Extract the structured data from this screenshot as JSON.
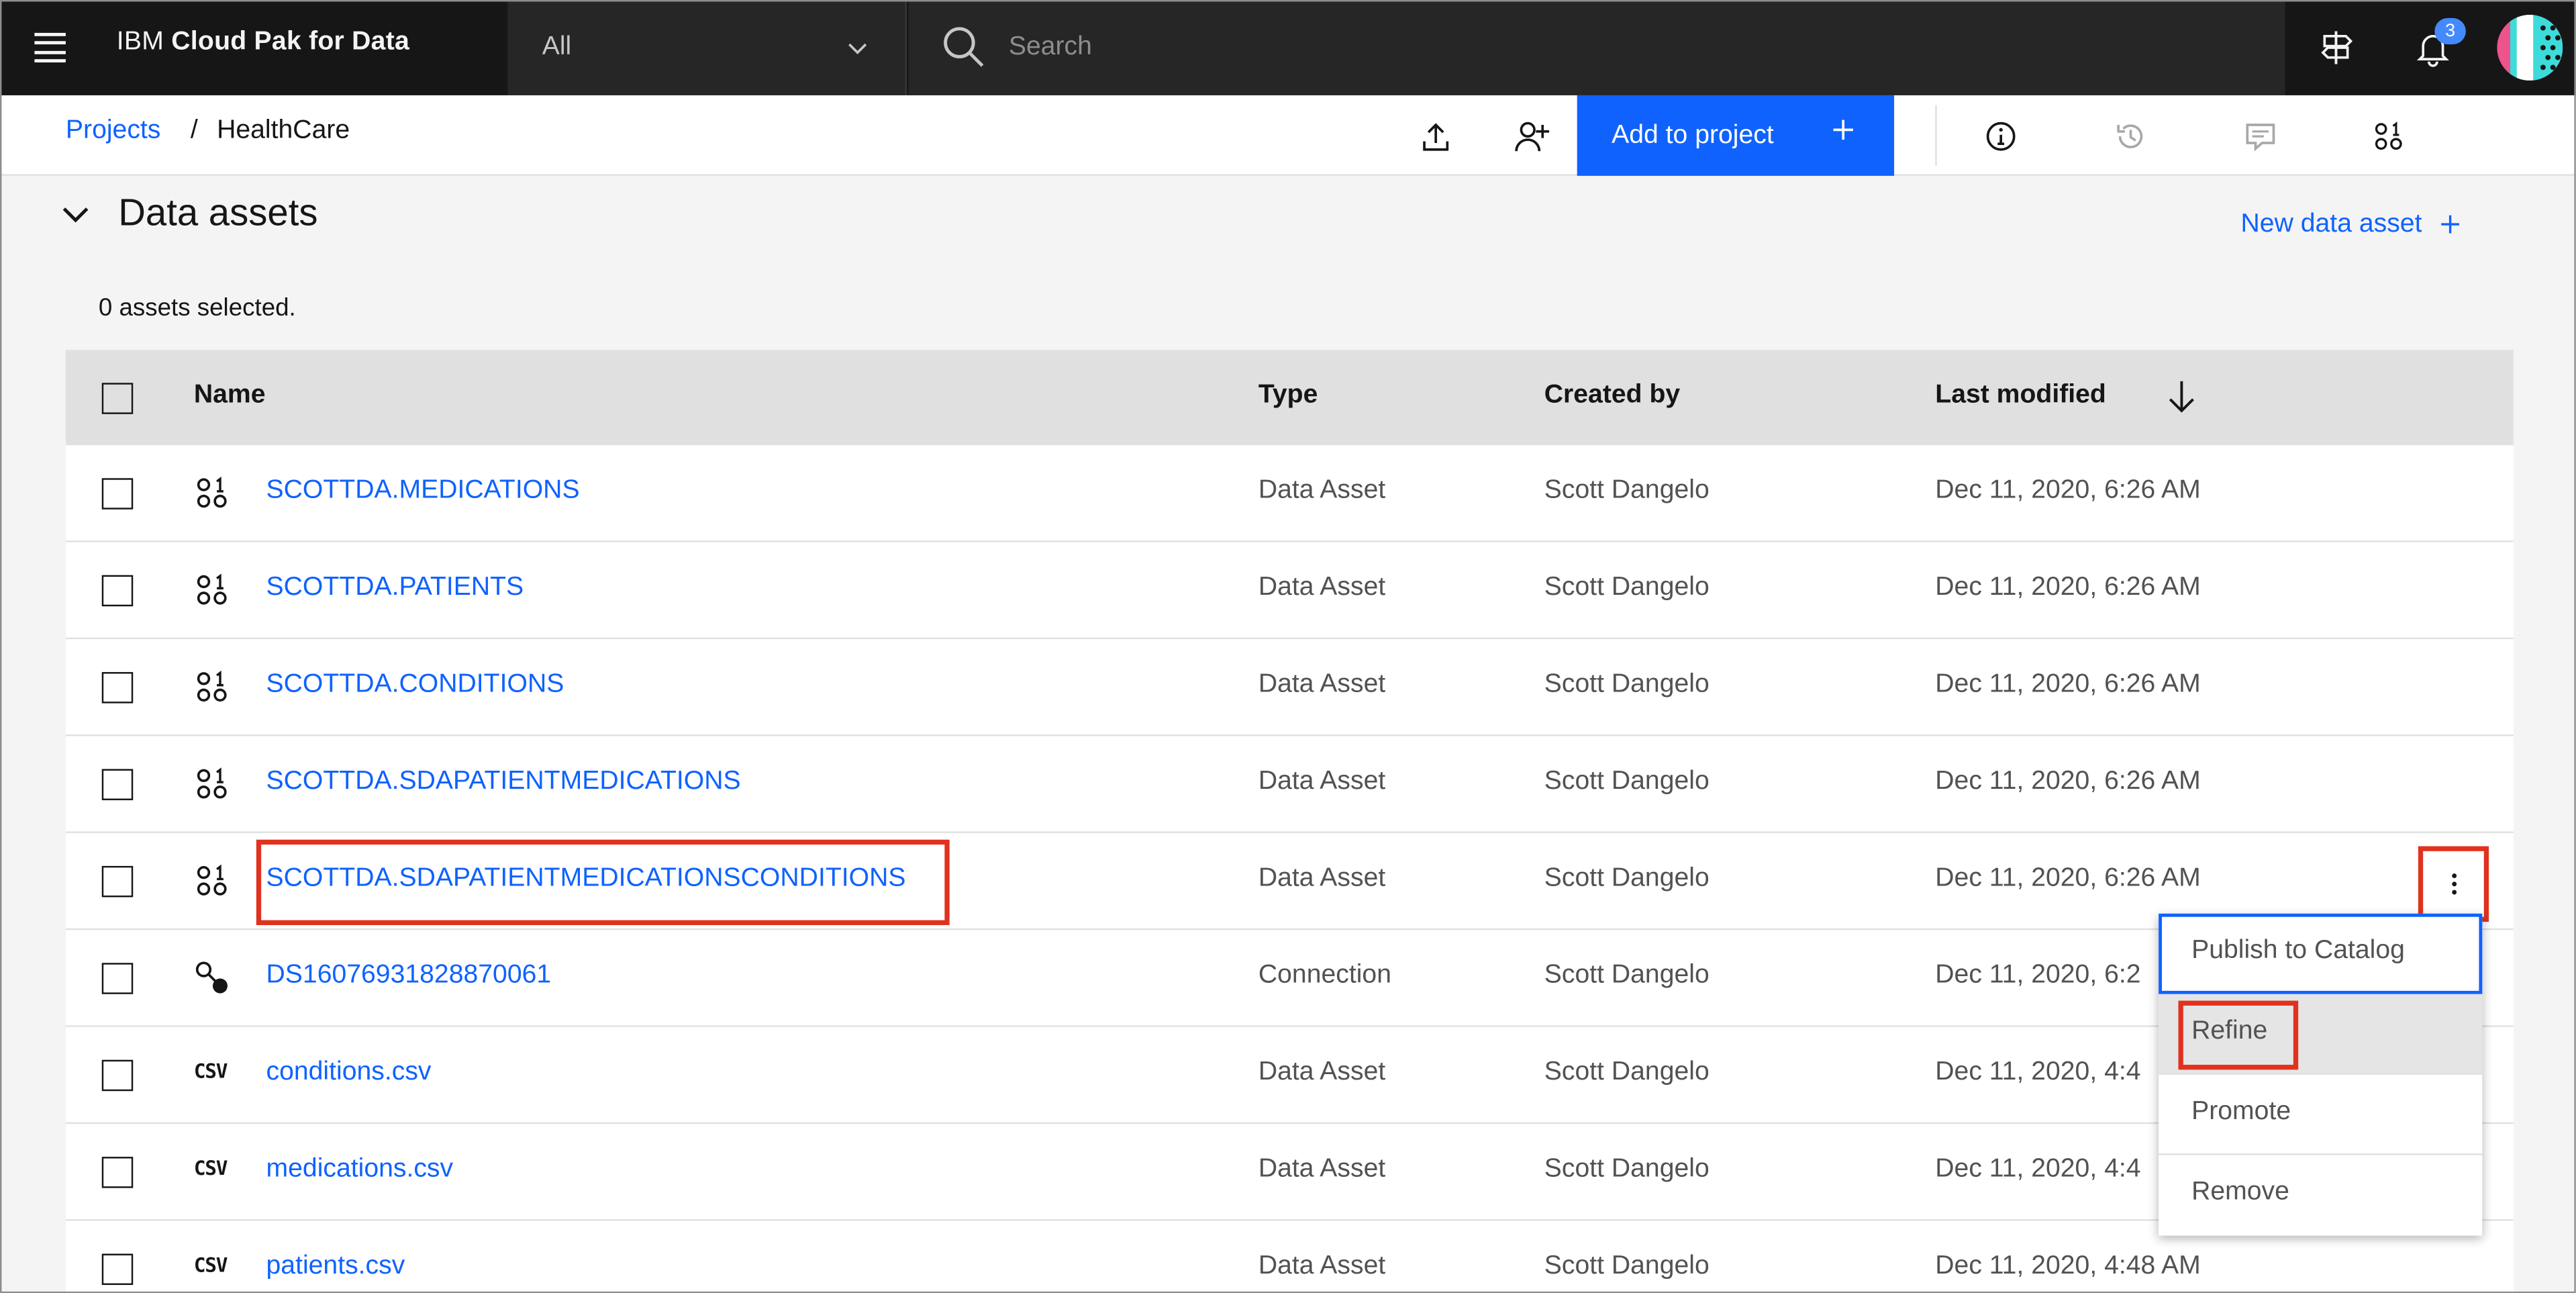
{
  "header": {
    "brand_prefix": "IBM",
    "brand_name": "Cloud Pak for Data",
    "scope_value": "All",
    "search_placeholder": "Search",
    "notification_count": "3"
  },
  "subheader": {
    "breadcrumb_link": "Projects",
    "breadcrumb_separator": "/",
    "breadcrumb_current": "HealthCare",
    "add_button_label": "Add to project"
  },
  "section": {
    "title": "Data assets",
    "new_asset_label": "New data asset",
    "selected_text": "0 assets selected."
  },
  "table": {
    "columns": [
      "Name",
      "Type",
      "Created by",
      "Last modified"
    ],
    "rows": [
      {
        "icon": "data-asset-icon",
        "name": "SCOTTDA.MEDICATIONS",
        "type": "Data Asset",
        "created_by": "Scott Dangelo",
        "modified": "Dec 11, 2020, 6:26 AM"
      },
      {
        "icon": "data-asset-icon",
        "name": "SCOTTDA.PATIENTS",
        "type": "Data Asset",
        "created_by": "Scott Dangelo",
        "modified": "Dec 11, 2020, 6:26 AM"
      },
      {
        "icon": "data-asset-icon",
        "name": "SCOTTDA.CONDITIONS",
        "type": "Data Asset",
        "created_by": "Scott Dangelo",
        "modified": "Dec 11, 2020, 6:26 AM"
      },
      {
        "icon": "data-asset-icon",
        "name": "SCOTTDA.SDAPATIENTMEDICATIONS",
        "type": "Data Asset",
        "created_by": "Scott Dangelo",
        "modified": "Dec 11, 2020, 6:26 AM"
      },
      {
        "icon": "data-asset-icon",
        "name": "SCOTTDA.SDAPATIENTMEDICATIONSCONDITIONS",
        "type": "Data Asset",
        "created_by": "Scott Dangelo",
        "modified": "Dec 11, 2020, 6:26 AM"
      },
      {
        "icon": "connection-icon",
        "name": "DS16076931828870061",
        "type": "Connection",
        "created_by": "Scott Dangelo",
        "modified": "Dec 11, 2020, 6:2"
      },
      {
        "icon": "csv-icon",
        "icon_text": "CSV",
        "name": "conditions.csv",
        "type": "Data Asset",
        "created_by": "Scott Dangelo",
        "modified": "Dec 11, 2020, 4:4"
      },
      {
        "icon": "csv-icon",
        "icon_text": "CSV",
        "name": "medications.csv",
        "type": "Data Asset",
        "created_by": "Scott Dangelo",
        "modified": "Dec 11, 2020, 4:4"
      },
      {
        "icon": "csv-icon",
        "icon_text": "CSV",
        "name": "patients.csv",
        "type": "Data Asset",
        "created_by": "Scott Dangelo",
        "modified": "Dec 11, 2020, 4:48 AM"
      }
    ]
  },
  "overflow_menu": {
    "items": [
      "Publish to Catalog",
      "Refine",
      "Promote",
      "Remove"
    ]
  },
  "colors": {
    "accent": "#0f62fe",
    "highlight": "#e0321e",
    "header_bg": "#161616"
  }
}
